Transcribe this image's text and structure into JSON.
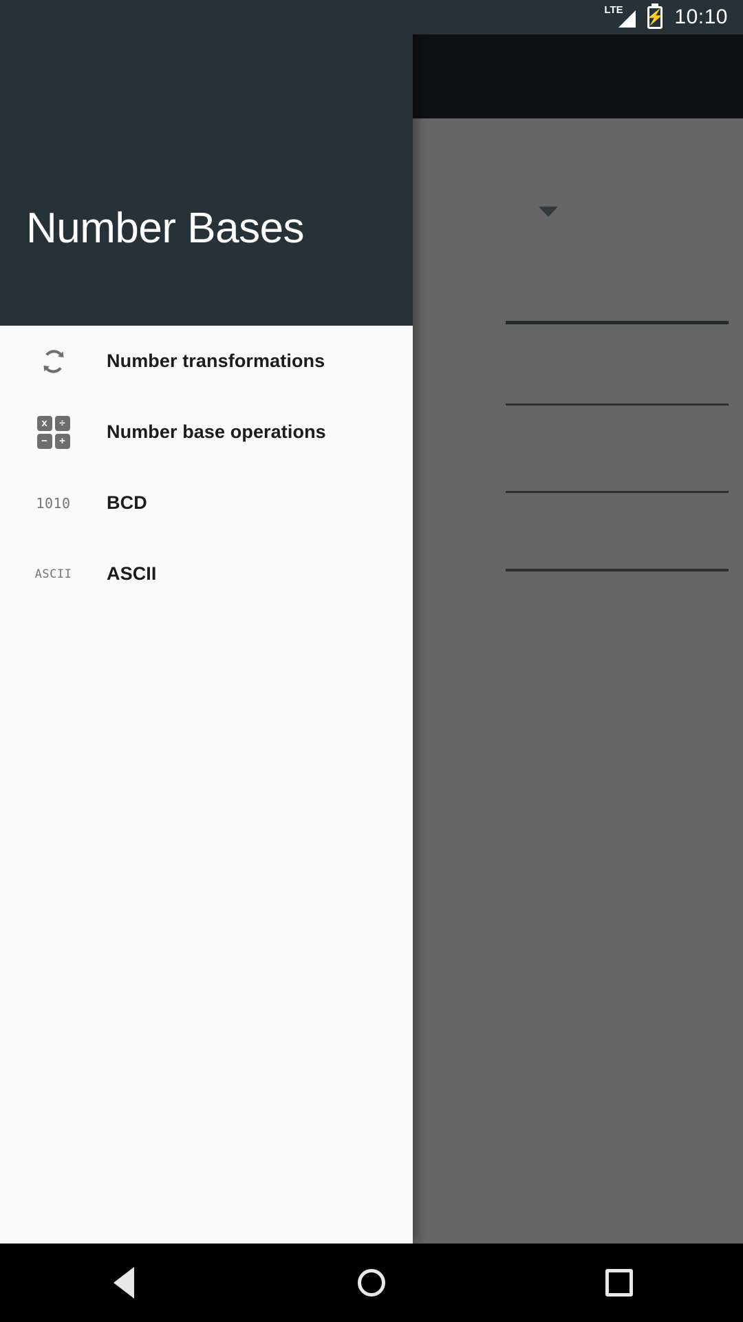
{
  "statusbar": {
    "network_label": "LTE",
    "signal_icon": "signal-bars-icon",
    "battery_icon": "battery-charging-icon",
    "battery_glyph": "⚡",
    "time": "10:10"
  },
  "drawer": {
    "title": "Number Bases",
    "header_bg": "#263238",
    "surface_bg": "#fafafa",
    "items": [
      {
        "icon": "sync-arrows-icon",
        "label": "Number transformations"
      },
      {
        "icon": "calculator-operations-icon",
        "label": "Number base operations",
        "keys": [
          "x",
          "÷",
          "−",
          "+"
        ]
      },
      {
        "icon": "binary-1010-icon",
        "icon_text": "1010",
        "label": "BCD"
      },
      {
        "icon": "ascii-text-icon",
        "icon_text": "ASCII",
        "label": "ASCII"
      }
    ]
  },
  "background_activity": {
    "appbar_color": "#0c1114",
    "content_color": "#666666",
    "spinner_icon": "dropdown-caret-icon",
    "dividers": 4
  },
  "navbar": {
    "back_icon": "back-triangle-icon",
    "home_icon": "home-circle-icon",
    "recents_icon": "recents-square-icon"
  }
}
